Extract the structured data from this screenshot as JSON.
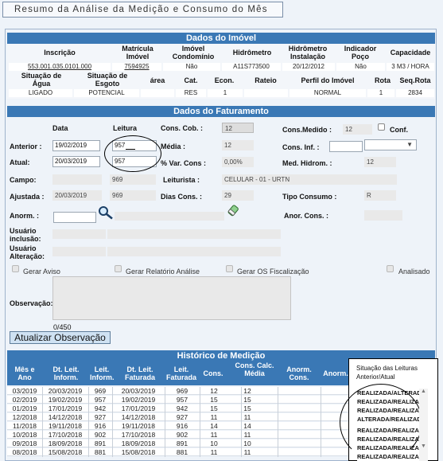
{
  "header": {
    "title": "Resumo da Análise da Medição e Consumo do Mês"
  },
  "imovel": {
    "section_title": "Dados do Imóvel",
    "headers": [
      "Inscrição",
      "Matrícula Imóvel",
      "Imóvel Condomínio",
      "Hidrômetro",
      "Hidrômetro Instalação",
      "Indicador Poço",
      "Capacidade"
    ],
    "values": [
      "553.001.035.0101.000",
      "7594925",
      "Não",
      "A11S773500",
      "20/12/2012",
      "Não",
      "3 M3 / HORA"
    ],
    "headers2": [
      "Situação de Água",
      "Situação de Esgoto",
      "área",
      "Cat.",
      "Econ.",
      "Rateio",
      "Perfil do Imóvel",
      "Rota",
      "Seq.Rota"
    ],
    "values2": [
      "LIGADO",
      "POTENCIAL",
      "",
      "RES",
      "1",
      "",
      "NORMAL",
      "1",
      "2834"
    ]
  },
  "faturamento": {
    "section_title": "Dados do Faturamento",
    "col_data": "Data",
    "col_leitura": "Leitura",
    "anterior_label": "Anterior :",
    "anterior_data": "19/02/2019",
    "anterior_leitura": "957",
    "atual_label": "Atual:",
    "atual_data": "20/03/2019",
    "atual_leitura": "957",
    "campo_label": "Campo:",
    "campo_leitura": "969",
    "ajustada_label": "Ajustada :",
    "ajustada_data": "20/03/2019",
    "ajustada_leitura": "969",
    "cons_cob_label": "Cons. Cob. :",
    "cons_cob": "12",
    "media_label": "Média :",
    "media": "12",
    "var_cons_label": "% Var. Cons :",
    "var_cons": "0,00%",
    "leiturista_label": "Leiturista :",
    "leiturista": "CELULAR - 01 - URTN",
    "dias_cons_label": "Dias Cons. :",
    "dias_cons": "29",
    "cons_medido_label": "Cons.Medido :",
    "cons_medido": "12",
    "conf_label": "Conf.",
    "cons_inf_label": "Cons. Inf. :",
    "cons_inf": "",
    "cons_inf_select": "",
    "med_hidrom_label": "Med. Hidrom. :",
    "med_hidrom": "12",
    "tipo_consumo_label": "Tipo Consumo :",
    "tipo_consumo": "R",
    "anorm_label": "Anorm. :",
    "anorm": "",
    "anor_cons_label": "Anor. Cons. :",
    "anor_cons": "",
    "usuario_inclusao_label": "Usuário inclusão:",
    "usuario_alteracao_label": "Usuário Alteração:",
    "gerar_aviso": "Gerar Aviso",
    "gerar_relatorio": "Gerar Relatório Análise",
    "gerar_os": "Gerar OS Fiscalização",
    "analisado": "Analisado",
    "observacao_label": "Observação:",
    "observacao": "",
    "char_count": "0/450",
    "atualizar_label": "Atualizar Observação"
  },
  "historico": {
    "section_title": "Histórico de Medição",
    "headers": [
      "Mês e Ano",
      "Dt. Leit. Inform.",
      "Leit. Inform.",
      "Dt. Leit. Faturada",
      "Leit. Faturada",
      "Cons.",
      "Cons. Calc. Média",
      "Anorm. Cons.",
      "Anorm."
    ],
    "situacao_header": "Situação das Leituras Anterior/Atual",
    "rows": [
      {
        "mes": "03/2019",
        "dt_inf": "20/03/2019",
        "leit_inf": "969",
        "dt_fat": "20/03/2019",
        "leit_fat": "969",
        "cons": "12",
        "media": "12",
        "anorm_cons": "",
        "anorm": ""
      },
      {
        "mes": "02/2019",
        "dt_inf": "19/02/2019",
        "leit_inf": "957",
        "dt_fat": "19/02/2019",
        "leit_fat": "957",
        "cons": "15",
        "media": "15",
        "anorm_cons": "",
        "anorm": ""
      },
      {
        "mes": "01/2019",
        "dt_inf": "17/01/2019",
        "leit_inf": "942",
        "dt_fat": "17/01/2019",
        "leit_fat": "942",
        "cons": "15",
        "media": "15",
        "anorm_cons": "",
        "anorm": ""
      },
      {
        "mes": "12/2018",
        "dt_inf": "14/12/2018",
        "leit_inf": "927",
        "dt_fat": "14/12/2018",
        "leit_fat": "927",
        "cons": "11",
        "media": "11",
        "anorm_cons": "",
        "anorm": ""
      },
      {
        "mes": "11/2018",
        "dt_inf": "19/11/2018",
        "leit_inf": "916",
        "dt_fat": "19/11/2018",
        "leit_fat": "916",
        "cons": "14",
        "media": "14",
        "anorm_cons": "",
        "anorm": ""
      },
      {
        "mes": "10/2018",
        "dt_inf": "17/10/2018",
        "leit_inf": "902",
        "dt_fat": "17/10/2018",
        "leit_fat": "902",
        "cons": "11",
        "media": "11",
        "anorm_cons": "",
        "anorm": ""
      },
      {
        "mes": "09/2018",
        "dt_inf": "18/09/2018",
        "leit_inf": "891",
        "dt_fat": "18/09/2018",
        "leit_fat": "891",
        "cons": "10",
        "media": "10",
        "anorm_cons": "",
        "anorm": ""
      },
      {
        "mes": "08/2018",
        "dt_inf": "15/08/2018",
        "leit_inf": "881",
        "dt_fat": "15/08/2018",
        "leit_fat": "881",
        "cons": "11",
        "media": "11",
        "anorm_cons": "",
        "anorm": ""
      }
    ],
    "situacao": [
      "REALIZADA/ALTERADA",
      "REALIZADA/REALIZADA",
      "REALIZADA/REALIZADA",
      "ALTERADA/REALIZADA",
      "REALIZADA/REALIZADA",
      "REALIZADA/REALIZADA",
      "REALIZADA/REALIZADA",
      "REALIZADA/REALIZADA"
    ]
  },
  "colors": {
    "section_bar": "#3a78b5",
    "background": "#eef3f9"
  }
}
